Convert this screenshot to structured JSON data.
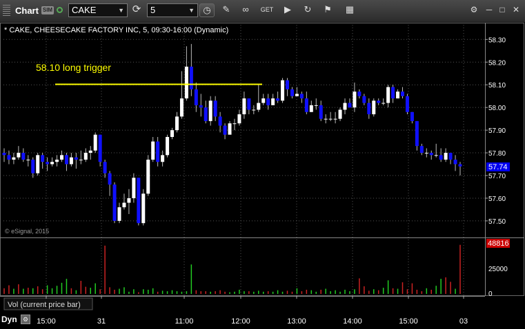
{
  "window": {
    "title": "Chart",
    "sim_badge": "SIM"
  },
  "toolbar": {
    "symbol_value": "CAKE",
    "interval_value": "5",
    "icons": [
      "clock-icon",
      "pencil-icon",
      "link-icon",
      "get-icon",
      "play-icon",
      "refresh-icon",
      "flag-icon",
      "grid-icon"
    ]
  },
  "chart_header": "* CAKE, CHEESECAKE FACTORY INC, 5, 09:30-16:00 (Dynamic)",
  "annotation": {
    "text": "58.10 long trigger",
    "price": 58.1,
    "color": "#ffff00"
  },
  "watermark": "© eSignal, 2015",
  "current_price": "57.74",
  "volume_panel": {
    "label": "Vol (current price bar)",
    "current_value": "48816"
  },
  "footer": {
    "label": "Dyn"
  },
  "colors": {
    "up": "#ffffff",
    "down": "#1010ff",
    "vol_up": "#22cc22",
    "vol_down": "#cc2222",
    "grid": "#555555",
    "price_box": "#0000ee",
    "vol_box": "#cc0000"
  },
  "chart_data": [
    {
      "type": "candlestick",
      "title": "CAKE, CHEESECAKE FACTORY INC, 5, 09:30-16:00 (Dynamic)",
      "ylim": [
        57.45,
        58.35
      ],
      "y_ticks": [
        "58.30",
        "58.20",
        "58.10",
        "58.00",
        "57.90",
        "57.80",
        "57.70",
        "57.60",
        "57.50"
      ],
      "x_ticks": [
        "15:00",
        "31",
        "11:00",
        "12:00",
        "13:00",
        "14:00",
        "15:00",
        "03"
      ],
      "grid": true,
      "candles": [
        [
          57.8,
          57.79,
          57.82,
          57.76
        ],
        [
          57.79,
          57.77,
          57.81,
          57.75
        ],
        [
          57.77,
          57.78,
          57.8,
          57.75
        ],
        [
          57.78,
          57.8,
          57.83,
          57.77
        ],
        [
          57.8,
          57.77,
          57.82,
          57.76
        ],
        [
          57.77,
          57.77,
          57.79,
          57.74
        ],
        [
          57.77,
          57.71,
          57.78,
          57.69
        ],
        [
          57.71,
          57.79,
          57.8,
          57.7
        ],
        [
          57.79,
          57.76,
          57.8,
          57.73
        ],
        [
          57.76,
          57.75,
          57.78,
          57.72
        ],
        [
          57.75,
          57.76,
          57.78,
          57.74
        ],
        [
          57.76,
          57.77,
          57.79,
          57.74
        ],
        [
          57.77,
          57.79,
          57.81,
          57.76
        ],
        [
          57.79,
          57.75,
          57.8,
          57.72
        ],
        [
          57.75,
          57.78,
          57.8,
          57.74
        ],
        [
          57.78,
          57.77,
          57.8,
          57.73
        ],
        [
          57.77,
          57.77,
          57.81,
          57.75
        ],
        [
          57.77,
          57.8,
          57.82,
          57.76
        ],
        [
          57.8,
          57.81,
          57.83,
          57.77
        ],
        [
          57.81,
          57.88,
          57.89,
          57.8
        ],
        [
          57.88,
          57.76,
          57.88,
          57.74
        ],
        [
          57.76,
          57.71,
          57.77,
          57.69
        ],
        [
          57.71,
          57.66,
          57.72,
          57.61
        ],
        [
          57.66,
          57.5,
          57.67,
          57.49
        ],
        [
          57.5,
          57.56,
          57.58,
          57.49
        ],
        [
          57.56,
          57.58,
          57.62,
          57.55
        ],
        [
          57.58,
          57.6,
          57.64,
          57.53
        ],
        [
          57.6,
          57.69,
          57.71,
          57.58
        ],
        [
          57.69,
          57.49,
          57.69,
          57.48
        ],
        [
          57.49,
          57.62,
          57.64,
          57.48
        ],
        [
          57.62,
          57.77,
          57.79,
          57.61
        ],
        [
          57.77,
          57.85,
          57.87,
          57.76
        ],
        [
          57.85,
          57.76,
          57.87,
          57.74
        ],
        [
          57.76,
          57.79,
          57.81,
          57.74
        ],
        [
          57.79,
          57.87,
          57.88,
          57.78
        ],
        [
          57.87,
          57.9,
          57.91,
          57.86
        ],
        [
          57.9,
          57.96,
          57.98,
          57.89
        ],
        [
          57.96,
          58.04,
          58.16,
          57.95
        ],
        [
          58.04,
          58.18,
          58.27,
          58.03
        ],
        [
          58.18,
          58.08,
          58.28,
          58.05
        ],
        [
          58.08,
          58.01,
          58.11,
          57.98
        ],
        [
          58.01,
          58.0,
          58.06,
          57.96
        ],
        [
          58.0,
          57.94,
          58.03,
          57.93
        ],
        [
          57.94,
          58.03,
          58.05,
          57.92
        ],
        [
          58.03,
          57.96,
          58.05,
          57.94
        ],
        [
          57.96,
          57.92,
          57.98,
          57.89
        ],
        [
          57.92,
          57.88,
          57.93,
          57.86
        ],
        [
          57.88,
          57.93,
          57.94,
          57.89
        ],
        [
          57.93,
          57.93,
          57.95,
          57.9
        ],
        [
          57.93,
          57.97,
          57.99,
          57.92
        ],
        [
          57.97,
          58.04,
          58.07,
          57.95
        ],
        [
          58.04,
          57.99,
          58.04,
          57.97
        ],
        [
          57.99,
          57.99,
          58.01,
          57.97
        ],
        [
          57.99,
          58.02,
          58.1,
          57.98
        ],
        [
          58.02,
          58.04,
          58.06,
          58.01
        ],
        [
          58.04,
          58.01,
          58.06,
          57.99
        ],
        [
          58.01,
          58.04,
          58.06,
          58.02
        ],
        [
          58.04,
          58.03,
          58.07,
          58.02
        ],
        [
          58.03,
          58.12,
          58.13,
          58.02
        ],
        [
          58.12,
          58.08,
          58.13,
          58.05
        ],
        [
          58.08,
          58.05,
          58.09,
          58.04
        ],
        [
          58.05,
          58.06,
          58.09,
          58.05
        ],
        [
          58.06,
          58.04,
          58.07,
          58.02
        ],
        [
          58.04,
          57.98,
          58.07,
          57.97
        ],
        [
          57.98,
          58.01,
          58.03,
          57.98
        ],
        [
          58.01,
          58.01,
          58.04,
          57.99
        ],
        [
          58.01,
          57.95,
          58.03,
          57.94
        ],
        [
          57.95,
          57.95,
          57.97,
          57.93
        ],
        [
          57.95,
          57.95,
          57.98,
          57.94
        ],
        [
          57.95,
          57.95,
          57.98,
          57.93
        ],
        [
          57.95,
          57.99,
          58.0,
          57.94
        ],
        [
          57.99,
          58.02,
          58.04,
          57.97
        ],
        [
          58.02,
          58.0,
          58.04,
          58.0
        ],
        [
          58.0,
          58.07,
          58.11,
          57.98
        ],
        [
          58.07,
          58.05,
          58.08,
          58.04
        ],
        [
          58.05,
          58.02,
          58.06,
          58.01
        ],
        [
          58.02,
          57.97,
          58.04,
          57.95
        ],
        [
          57.97,
          58.03,
          58.04,
          57.96
        ],
        [
          58.03,
          58.02,
          58.04,
          58.01
        ],
        [
          58.02,
          58.02,
          58.04,
          58.01
        ],
        [
          58.02,
          58.09,
          58.1,
          58.0
        ],
        [
          58.09,
          58.04,
          58.1,
          58.02
        ],
        [
          58.04,
          58.07,
          58.08,
          58.04
        ],
        [
          58.07,
          58.05,
          58.09,
          58.04
        ],
        [
          58.05,
          57.98,
          58.06,
          57.97
        ],
        [
          57.98,
          57.94,
          57.98,
          57.93
        ],
        [
          57.94,
          57.83,
          57.94,
          57.81
        ],
        [
          57.83,
          57.8,
          57.84,
          57.79
        ],
        [
          57.8,
          57.8,
          57.82,
          57.78
        ],
        [
          57.8,
          57.79,
          57.81,
          57.77
        ],
        [
          57.79,
          57.79,
          57.84,
          57.78
        ],
        [
          57.79,
          57.77,
          57.82,
          57.76
        ],
        [
          57.77,
          57.8,
          57.82,
          57.76
        ],
        [
          57.8,
          57.77,
          57.8,
          57.75
        ],
        [
          57.77,
          57.75,
          57.79,
          57.72
        ],
        [
          57.75,
          57.74,
          57.76,
          57.7
        ]
      ]
    },
    {
      "type": "bar",
      "title": "Vol (current price bar)",
      "y_ticks": [
        "25000",
        "0"
      ],
      "ylim": [
        0,
        50000
      ],
      "values": [
        5000,
        8000,
        4500,
        9000,
        4500,
        5500,
        5000,
        7000,
        4000,
        8000,
        5000,
        7500,
        10500,
        14500,
        5000,
        3000,
        12500,
        6500,
        5500,
        10000,
        4000,
        48000,
        6000,
        3500,
        4500,
        6000,
        1500,
        4000,
        1000,
        4000,
        3500,
        5000,
        1500,
        2500,
        2000,
        3000,
        2000,
        1500,
        2000,
        29000,
        3000,
        2000,
        2000,
        1500,
        2000,
        3000,
        1500,
        1000,
        1500,
        3500,
        2000,
        2000,
        1500,
        2500,
        1500,
        2000,
        1500,
        3000,
        1500,
        2500,
        1500,
        5000,
        2000,
        3500,
        3000,
        1500,
        3500,
        4500,
        2000,
        3000,
        1500,
        3500,
        2000,
        4000,
        15000,
        7000,
        2500,
        4000,
        3000,
        5500,
        13000,
        5000,
        4500,
        11000,
        4000,
        10000,
        3500,
        2000,
        5000,
        3500,
        7500,
        14500,
        16000,
        11500,
        4500,
        48816
      ],
      "colors": [
        "r",
        "r",
        "g",
        "r",
        "g",
        "r",
        "g",
        "r",
        "r",
        "g",
        "g",
        "g",
        "g",
        "g",
        "r",
        "g",
        "r",
        "r",
        "g",
        "g",
        "r",
        "r",
        "r",
        "r",
        "g",
        "g",
        "g",
        "g",
        "r",
        "g",
        "g",
        "g",
        "r",
        "g",
        "g",
        "g",
        "g",
        "g",
        "g",
        "g",
        "r",
        "r",
        "r",
        "g",
        "r",
        "r",
        "r",
        "g",
        "g",
        "g",
        "g",
        "r",
        "g",
        "g",
        "g",
        "r",
        "g",
        "g",
        "g",
        "r",
        "r",
        "g",
        "r",
        "r",
        "g",
        "g",
        "r",
        "g",
        "g",
        "g",
        "g",
        "g",
        "g",
        "g",
        "r",
        "r",
        "r",
        "g",
        "r",
        "g",
        "g",
        "r",
        "g",
        "r",
        "r",
        "r",
        "r",
        "r",
        "g",
        "r",
        "g",
        "g",
        "r",
        "r",
        "g",
        "r"
      ]
    }
  ]
}
